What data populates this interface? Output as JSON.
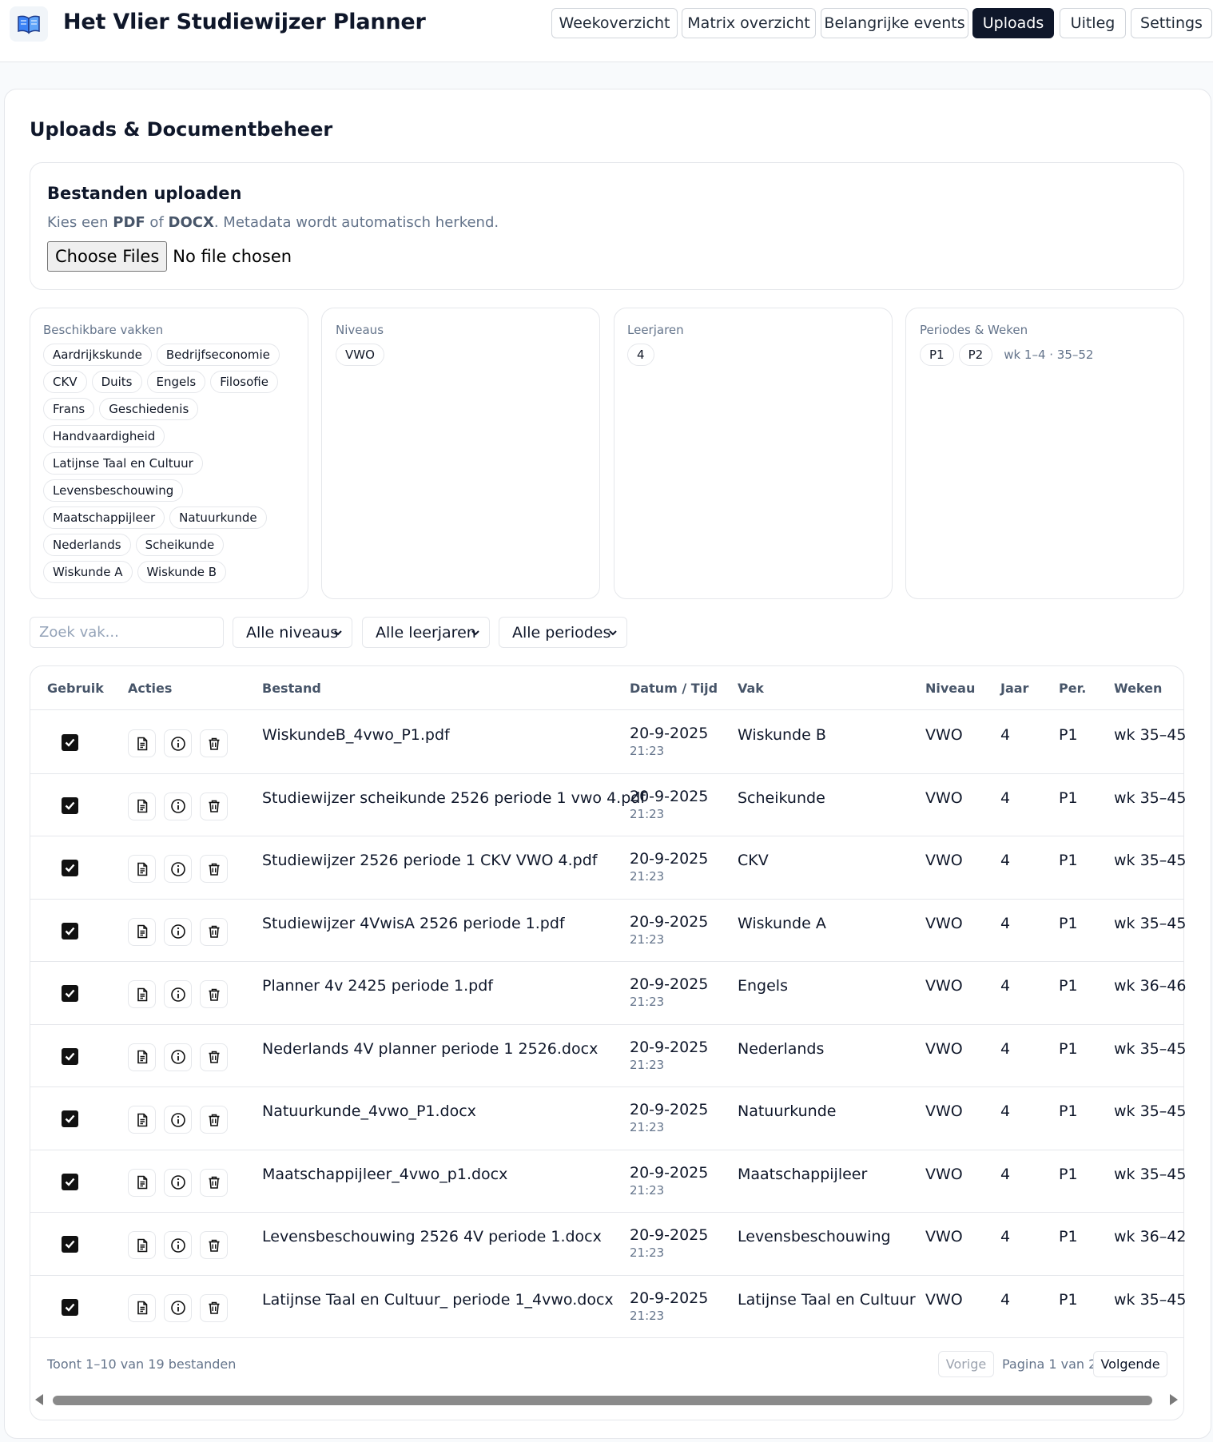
{
  "app": {
    "title": "Het Vlier Studiewijzer Planner",
    "logo_icon": "open-book-icon"
  },
  "nav": {
    "items": [
      {
        "label": "Weekoverzicht",
        "active": false
      },
      {
        "label": "Matrix overzicht",
        "active": false
      },
      {
        "label": "Belangrijke events",
        "active": false
      },
      {
        "label": "Uploads",
        "active": true
      },
      {
        "label": "Uitleg",
        "active": false
      },
      {
        "label": "Settings",
        "active": false
      }
    ]
  },
  "page": {
    "title": "Uploads & Documentbeheer"
  },
  "upload": {
    "title": "Bestanden uploaden",
    "hint_prefix": "Kies een ",
    "hint_pdf": "PDF",
    "hint_of": " of ",
    "hint_docx": "DOCX",
    "hint_suffix": ". Metadata wordt automatisch herkend.",
    "choose_label": "Choose Files",
    "no_file_label": "No file chosen"
  },
  "info": {
    "vakken": {
      "label": "Beschikbare vakken",
      "items": [
        "Aardrijkskunde",
        "Bedrijfseconomie",
        "CKV",
        "Duits",
        "Engels",
        "Filosofie",
        "Frans",
        "Geschiedenis",
        "Handvaardigheid",
        "Latijnse Taal en Cultuur",
        "Levensbeschouwing",
        "Maatschappijleer",
        "Natuurkunde",
        "Nederlands",
        "Scheikunde",
        "Wiskunde A",
        "Wiskunde B"
      ]
    },
    "niveaus": {
      "label": "Niveaus",
      "items": [
        "VWO"
      ]
    },
    "leerjaren": {
      "label": "Leerjaren",
      "items": [
        "4"
      ]
    },
    "periodes": {
      "label": "Periodes & Weken",
      "items": [
        "P1",
        "P2"
      ],
      "weeks": "wk 1–4 · 35–52"
    }
  },
  "filters": {
    "search_placeholder": "Zoek vak...",
    "niveau": "Alle niveaus",
    "leerjaar": "Alle leerjaren",
    "periode": "Alle periodes"
  },
  "table": {
    "headers": {
      "gebruik": "Gebruik",
      "acties": "Acties",
      "bestand": "Bestand",
      "datum": "Datum / Tijd",
      "vak": "Vak",
      "niveau": "Niveau",
      "jaar": "Jaar",
      "per": "Per.",
      "weken": "Weken"
    },
    "rows": [
      {
        "checked": true,
        "file": "WiskundeB_4vwo_P1.pdf",
        "date": "20-9-2025",
        "time": "21:23",
        "vak": "Wiskunde B",
        "niveau": "VWO",
        "jaar": "4",
        "per": "P1",
        "weken": "wk 35–45"
      },
      {
        "checked": true,
        "file": "Studiewijzer scheikunde 2526 periode 1 vwo 4.pdf",
        "date": "20-9-2025",
        "time": "21:23",
        "vak": "Scheikunde",
        "niveau": "VWO",
        "jaar": "4",
        "per": "P1",
        "weken": "wk 35–45"
      },
      {
        "checked": true,
        "file": "Studiewijzer 2526 periode 1 CKV VWO 4.pdf",
        "date": "20-9-2025",
        "time": "21:23",
        "vak": "CKV",
        "niveau": "VWO",
        "jaar": "4",
        "per": "P1",
        "weken": "wk 35–45"
      },
      {
        "checked": true,
        "file": "Studiewijzer 4VwisA 2526 periode 1.pdf",
        "date": "20-9-2025",
        "time": "21:23",
        "vak": "Wiskunde A",
        "niveau": "VWO",
        "jaar": "4",
        "per": "P1",
        "weken": "wk 35–45"
      },
      {
        "checked": true,
        "file": "Planner 4v 2425 periode 1.pdf",
        "date": "20-9-2025",
        "time": "21:23",
        "vak": "Engels",
        "niveau": "VWO",
        "jaar": "4",
        "per": "P1",
        "weken": "wk 36–46"
      },
      {
        "checked": true,
        "file": "Nederlands 4V planner periode 1 2526.docx",
        "date": "20-9-2025",
        "time": "21:23",
        "vak": "Nederlands",
        "niveau": "VWO",
        "jaar": "4",
        "per": "P1",
        "weken": "wk 35–45"
      },
      {
        "checked": true,
        "file": "Natuurkunde_4vwo_P1.docx",
        "date": "20-9-2025",
        "time": "21:23",
        "vak": "Natuurkunde",
        "niveau": "VWO",
        "jaar": "4",
        "per": "P1",
        "weken": "wk 35–45"
      },
      {
        "checked": true,
        "file": "Maatschappijleer_4vwo_p1.docx",
        "date": "20-9-2025",
        "time": "21:23",
        "vak": "Maatschappijleer",
        "niveau": "VWO",
        "jaar": "4",
        "per": "P1",
        "weken": "wk 35–45"
      },
      {
        "checked": true,
        "file": "Levensbeschouwing 2526 4V periode 1.docx",
        "date": "20-9-2025",
        "time": "21:23",
        "vak": "Levensbeschouwing",
        "niveau": "VWO",
        "jaar": "4",
        "per": "P1",
        "weken": "wk 36–42"
      },
      {
        "checked": true,
        "file": "Latijnse Taal en Cultuur_ periode 1_4vwo.docx",
        "date": "20-9-2025",
        "time": "21:23",
        "vak": "Latijnse Taal en Cultuur",
        "niveau": "VWO",
        "jaar": "4",
        "per": "P1",
        "weken": "wk 35–45"
      }
    ],
    "row_action_icons": [
      "document-icon",
      "info-icon",
      "trash-icon"
    ]
  },
  "pagination": {
    "summary": "Toont 1–10 van 19 bestanden",
    "prev_label": "Vorige",
    "page_label": "Pagina 1 van 2",
    "next_label": "Volgende"
  }
}
